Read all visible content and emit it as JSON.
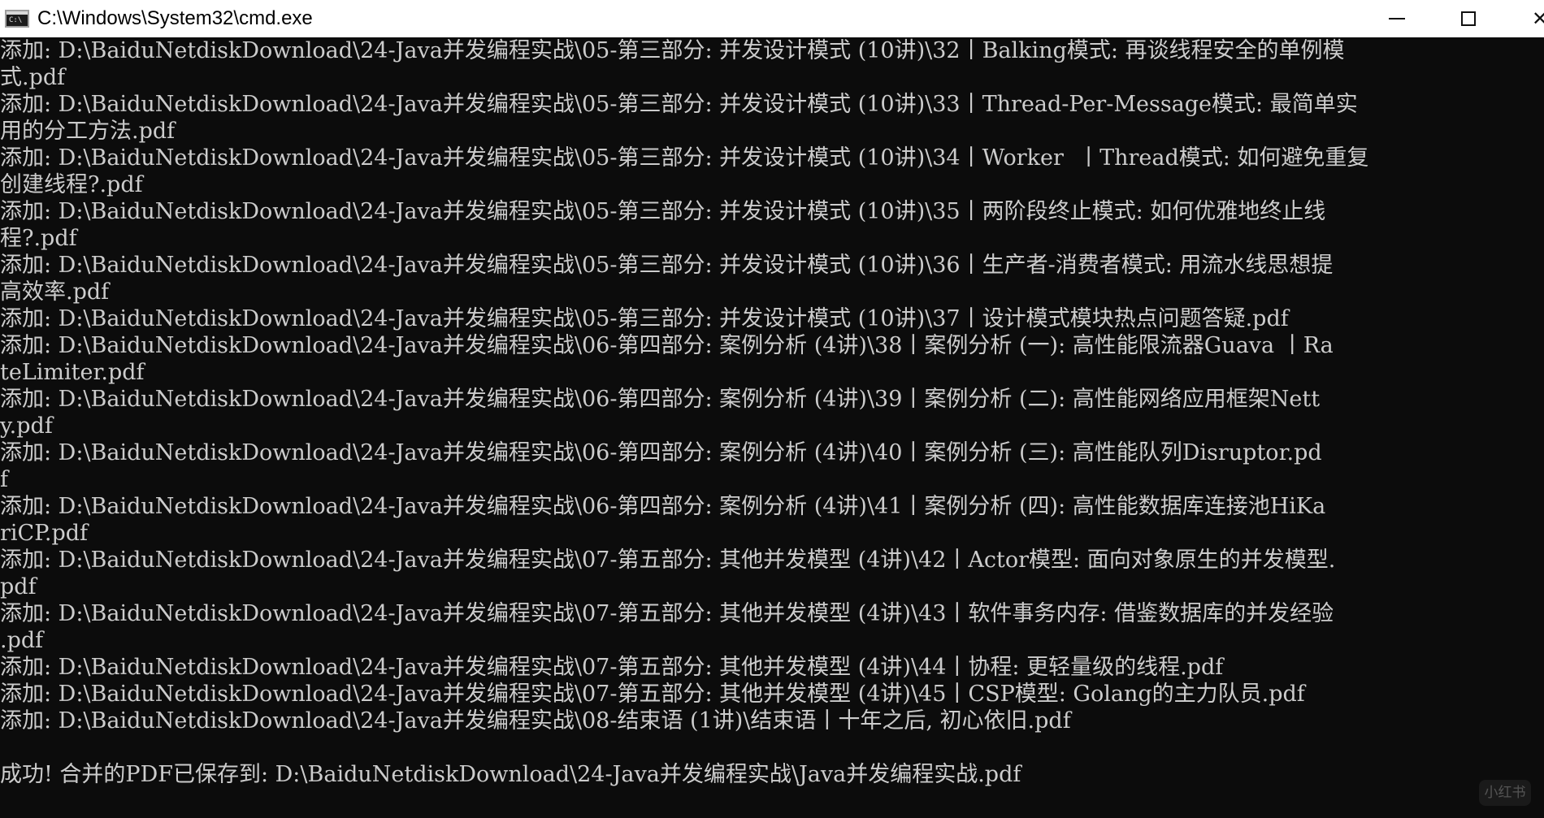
{
  "window": {
    "title": "C:\\Windows\\System32\\cmd.exe",
    "icon": "terminal-icon",
    "controls": {
      "minimize": "minimize-icon",
      "maximize": "maximize-icon",
      "close": "close-icon"
    }
  },
  "console": {
    "lines": [
      "添加: D:\\BaiduNetdiskDownload\\24-Java并发编程实战\\05-第三部分: 并发设计模式 (10讲)\\32丨Balking模式: 再谈线程安全的单例模",
      "式.pdf",
      "添加: D:\\BaiduNetdiskDownload\\24-Java并发编程实战\\05-第三部分: 并发设计模式 (10讲)\\33丨Thread-Per-Message模式: 最简单实",
      "用的分工方法.pdf",
      "添加: D:\\BaiduNetdiskDownload\\24-Java并发编程实战\\05-第三部分: 并发设计模式 (10讲)\\34丨Worker  丨Thread模式: 如何避免重复",
      "创建线程?.pdf",
      "添加: D:\\BaiduNetdiskDownload\\24-Java并发编程实战\\05-第三部分: 并发设计模式 (10讲)\\35丨两阶段终止模式: 如何优雅地终止线",
      "程?.pdf",
      "添加: D:\\BaiduNetdiskDownload\\24-Java并发编程实战\\05-第三部分: 并发设计模式 (10讲)\\36丨生产者-消费者模式: 用流水线思想提",
      "高效率.pdf",
      "添加: D:\\BaiduNetdiskDownload\\24-Java并发编程实战\\05-第三部分: 并发设计模式 (10讲)\\37丨设计模式模块热点问题答疑.pdf",
      "添加: D:\\BaiduNetdiskDownload\\24-Java并发编程实战\\06-第四部分: 案例分析 (4讲)\\38丨案例分析 (一): 高性能限流器Guava 丨Ra",
      "teLimiter.pdf",
      "添加: D:\\BaiduNetdiskDownload\\24-Java并发编程实战\\06-第四部分: 案例分析 (4讲)\\39丨案例分析 (二): 高性能网络应用框架Nett",
      "y.pdf",
      "添加: D:\\BaiduNetdiskDownload\\24-Java并发编程实战\\06-第四部分: 案例分析 (4讲)\\40丨案例分析 (三): 高性能队列Disruptor.pd",
      "f",
      "添加: D:\\BaiduNetdiskDownload\\24-Java并发编程实战\\06-第四部分: 案例分析 (4讲)\\41丨案例分析 (四): 高性能数据库连接池HiKa",
      "riCP.pdf",
      "添加: D:\\BaiduNetdiskDownload\\24-Java并发编程实战\\07-第五部分: 其他并发模型 (4讲)\\42丨Actor模型: 面向对象原生的并发模型.",
      "pdf",
      "添加: D:\\BaiduNetdiskDownload\\24-Java并发编程实战\\07-第五部分: 其他并发模型 (4讲)\\43丨软件事务内存: 借鉴数据库的并发经验",
      ".pdf",
      "添加: D:\\BaiduNetdiskDownload\\24-Java并发编程实战\\07-第五部分: 其他并发模型 (4讲)\\44丨协程: 更轻量级的线程.pdf",
      "添加: D:\\BaiduNetdiskDownload\\24-Java并发编程实战\\07-第五部分: 其他并发模型 (4讲)\\45丨CSP模型: Golang的主力队员.pdf",
      "添加: D:\\BaiduNetdiskDownload\\24-Java并发编程实战\\08-结束语 (1讲)\\结束语丨十年之后, 初心依旧.pdf",
      "",
      "成功! 合并的PDF已保存到: D:\\BaiduNetdiskDownload\\24-Java并发编程实战\\Java并发编程实战.pdf"
    ]
  },
  "watermark": {
    "text": "小红书"
  },
  "colors": {
    "console_bg": "#0c0c0c",
    "console_text": "#cccccc",
    "titlebar_bg": "#ffffff"
  }
}
